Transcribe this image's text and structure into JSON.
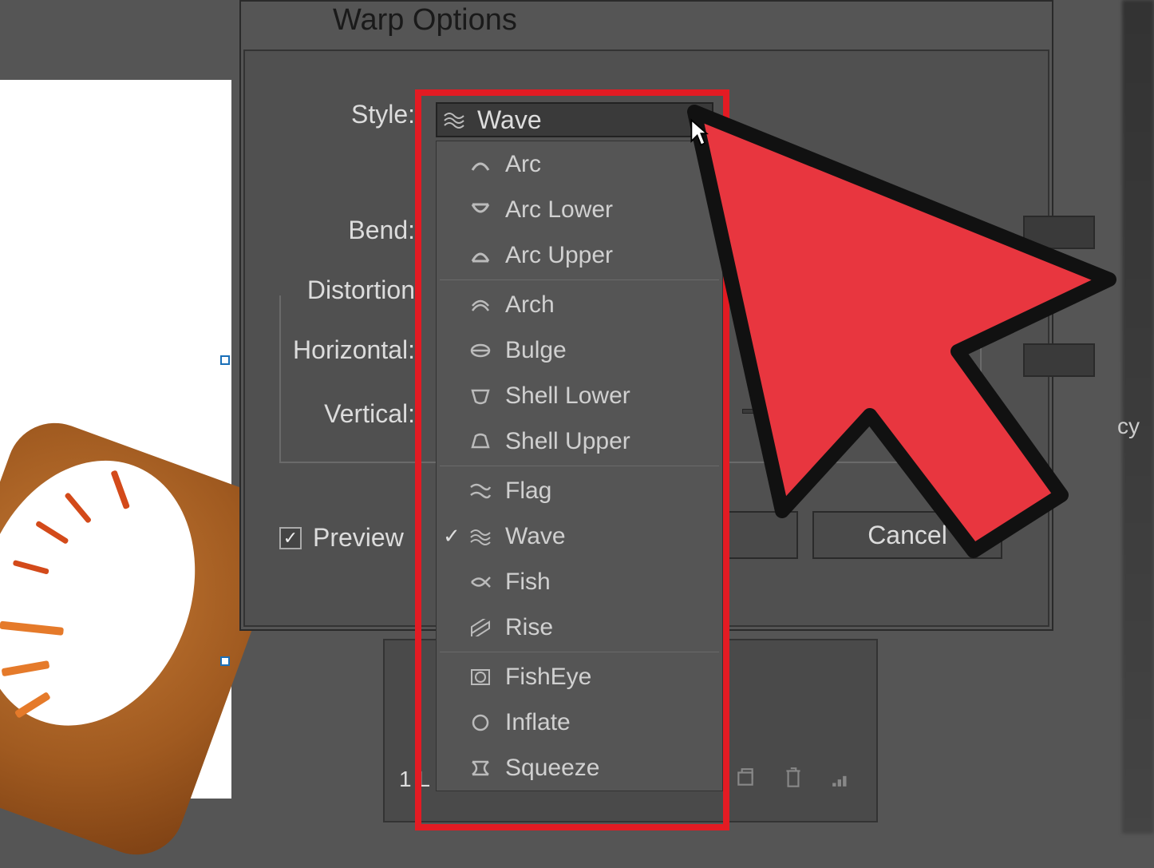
{
  "dialog": {
    "title": "Warp Options",
    "style_label": "Style:",
    "bend_label": "Bend:",
    "distortion_label": "Distortion",
    "horizontal_label": "Horizontal:",
    "vertical_label": "Vertical:",
    "preview_label": "Preview",
    "preview_checked": true,
    "cancel_label": "Cancel"
  },
  "dropdown": {
    "selected": "Wave",
    "groups": [
      [
        {
          "icon": "arc",
          "label": "Arc"
        },
        {
          "icon": "arclower",
          "label": "Arc Lower"
        },
        {
          "icon": "arcupper",
          "label": "Arc Upper"
        }
      ],
      [
        {
          "icon": "arch",
          "label": "Arch"
        },
        {
          "icon": "bulge",
          "label": "Bulge"
        },
        {
          "icon": "shelllower",
          "label": "Shell Lower"
        },
        {
          "icon": "shellupper",
          "label": "Shell Upper"
        }
      ],
      [
        {
          "icon": "flag",
          "label": "Flag"
        },
        {
          "icon": "wave",
          "label": "Wave",
          "checked": true
        },
        {
          "icon": "fish",
          "label": "Fish"
        },
        {
          "icon": "rise",
          "label": "Rise"
        }
      ],
      [
        {
          "icon": "fisheye",
          "label": "FishEye"
        },
        {
          "icon": "inflate",
          "label": "Inflate"
        },
        {
          "icon": "squeeze",
          "label": "Squeeze"
        }
      ]
    ]
  },
  "side": {
    "cy": "cy"
  },
  "lower": {
    "page": "1 L"
  },
  "colors": {
    "highlight": "#e31b23",
    "panel": "#555555",
    "text": "#dcdcdc"
  }
}
